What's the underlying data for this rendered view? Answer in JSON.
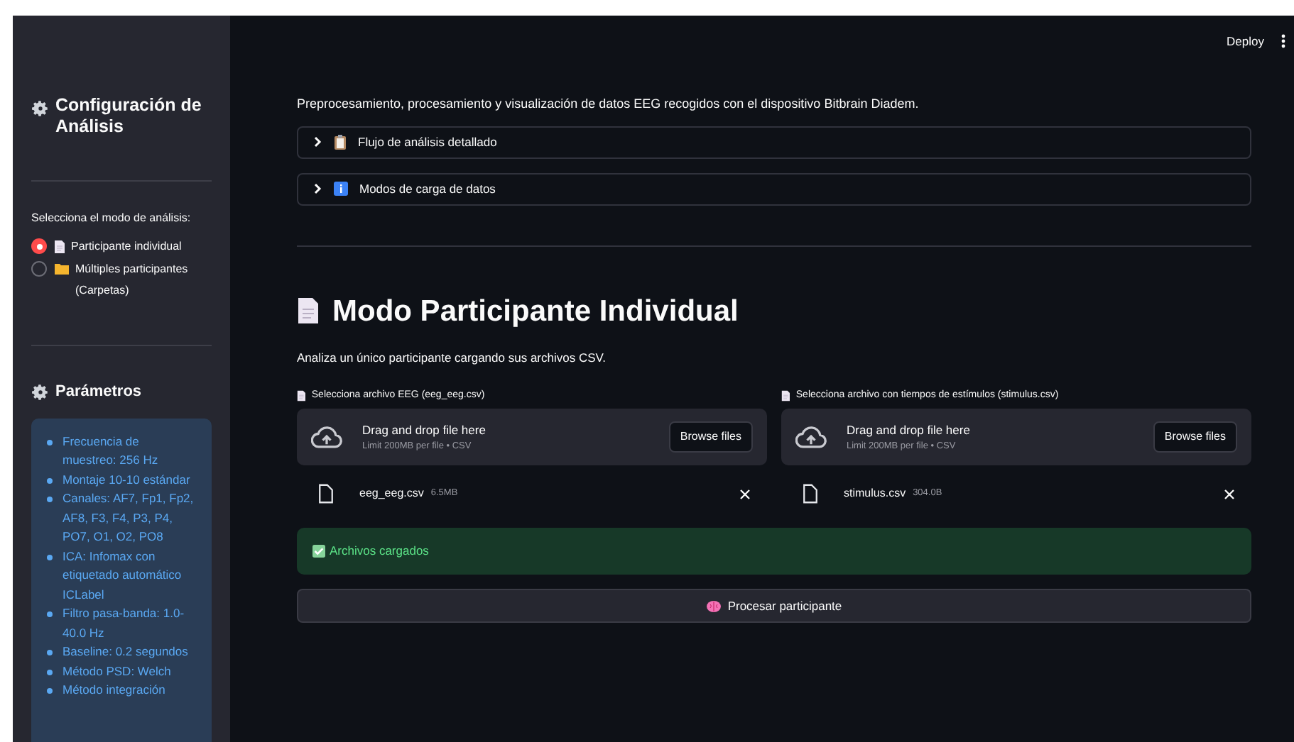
{
  "header": {
    "deploy": "Deploy"
  },
  "sidebar": {
    "title": "Configuración de Análisis",
    "mode_label": "Selecciona el modo de análisis:",
    "modes": [
      {
        "label": "Participante individual",
        "kind": "document",
        "selected": true
      },
      {
        "label": "Múltiples participantes (Carpetas)",
        "kind": "folder",
        "selected": false
      }
    ],
    "params_title": "Parámetros",
    "params": [
      "Frecuencia de muestreo: 256 Hz",
      "Montaje 10-10 estándar",
      "Canales: AF7, Fp1, Fp2, AF8, F3, F4, P3, P4, PO7, O1, O2, PO8",
      "ICA: Infomax con etiquetado automático ICLabel",
      "Filtro pasa-banda: 1.0-40.0 Hz",
      "Baseline: 0.2 segundos",
      "Método PSD: Welch",
      "Método integración"
    ]
  },
  "main": {
    "subtitle": "Preprocesamiento, procesamiento y visualización de datos EEG recogidos con el dispositivo Bitbrain Diadem.",
    "expanders": [
      {
        "label": "Flujo de análisis detallado",
        "kind": "clipboard",
        "expanded": false
      },
      {
        "label": "Modos de carga de datos",
        "kind": "info",
        "expanded": false
      }
    ],
    "heading": "Modo Participante Individual",
    "caption": "Analiza un único participante cargando sus archivos CSV.",
    "uploaders": [
      {
        "label": "Selecciona archivo EEG (eeg_eeg.csv)",
        "drop": "Drag and drop file here",
        "limit": "Limit 200MB per file • CSV",
        "browse": "Browse files",
        "file": "eeg_eeg.csv",
        "size": "6.5MB"
      },
      {
        "label": "Selecciona archivo con tiempos de estímulos (stimulus.csv)",
        "drop": "Drag and drop file here",
        "limit": "Limit 200MB per file • CSV",
        "browse": "Browse files",
        "file": "stimulus.csv",
        "size": "304.0B"
      }
    ],
    "success": "Archivos cargados",
    "process_button": "Procesar participante"
  }
}
